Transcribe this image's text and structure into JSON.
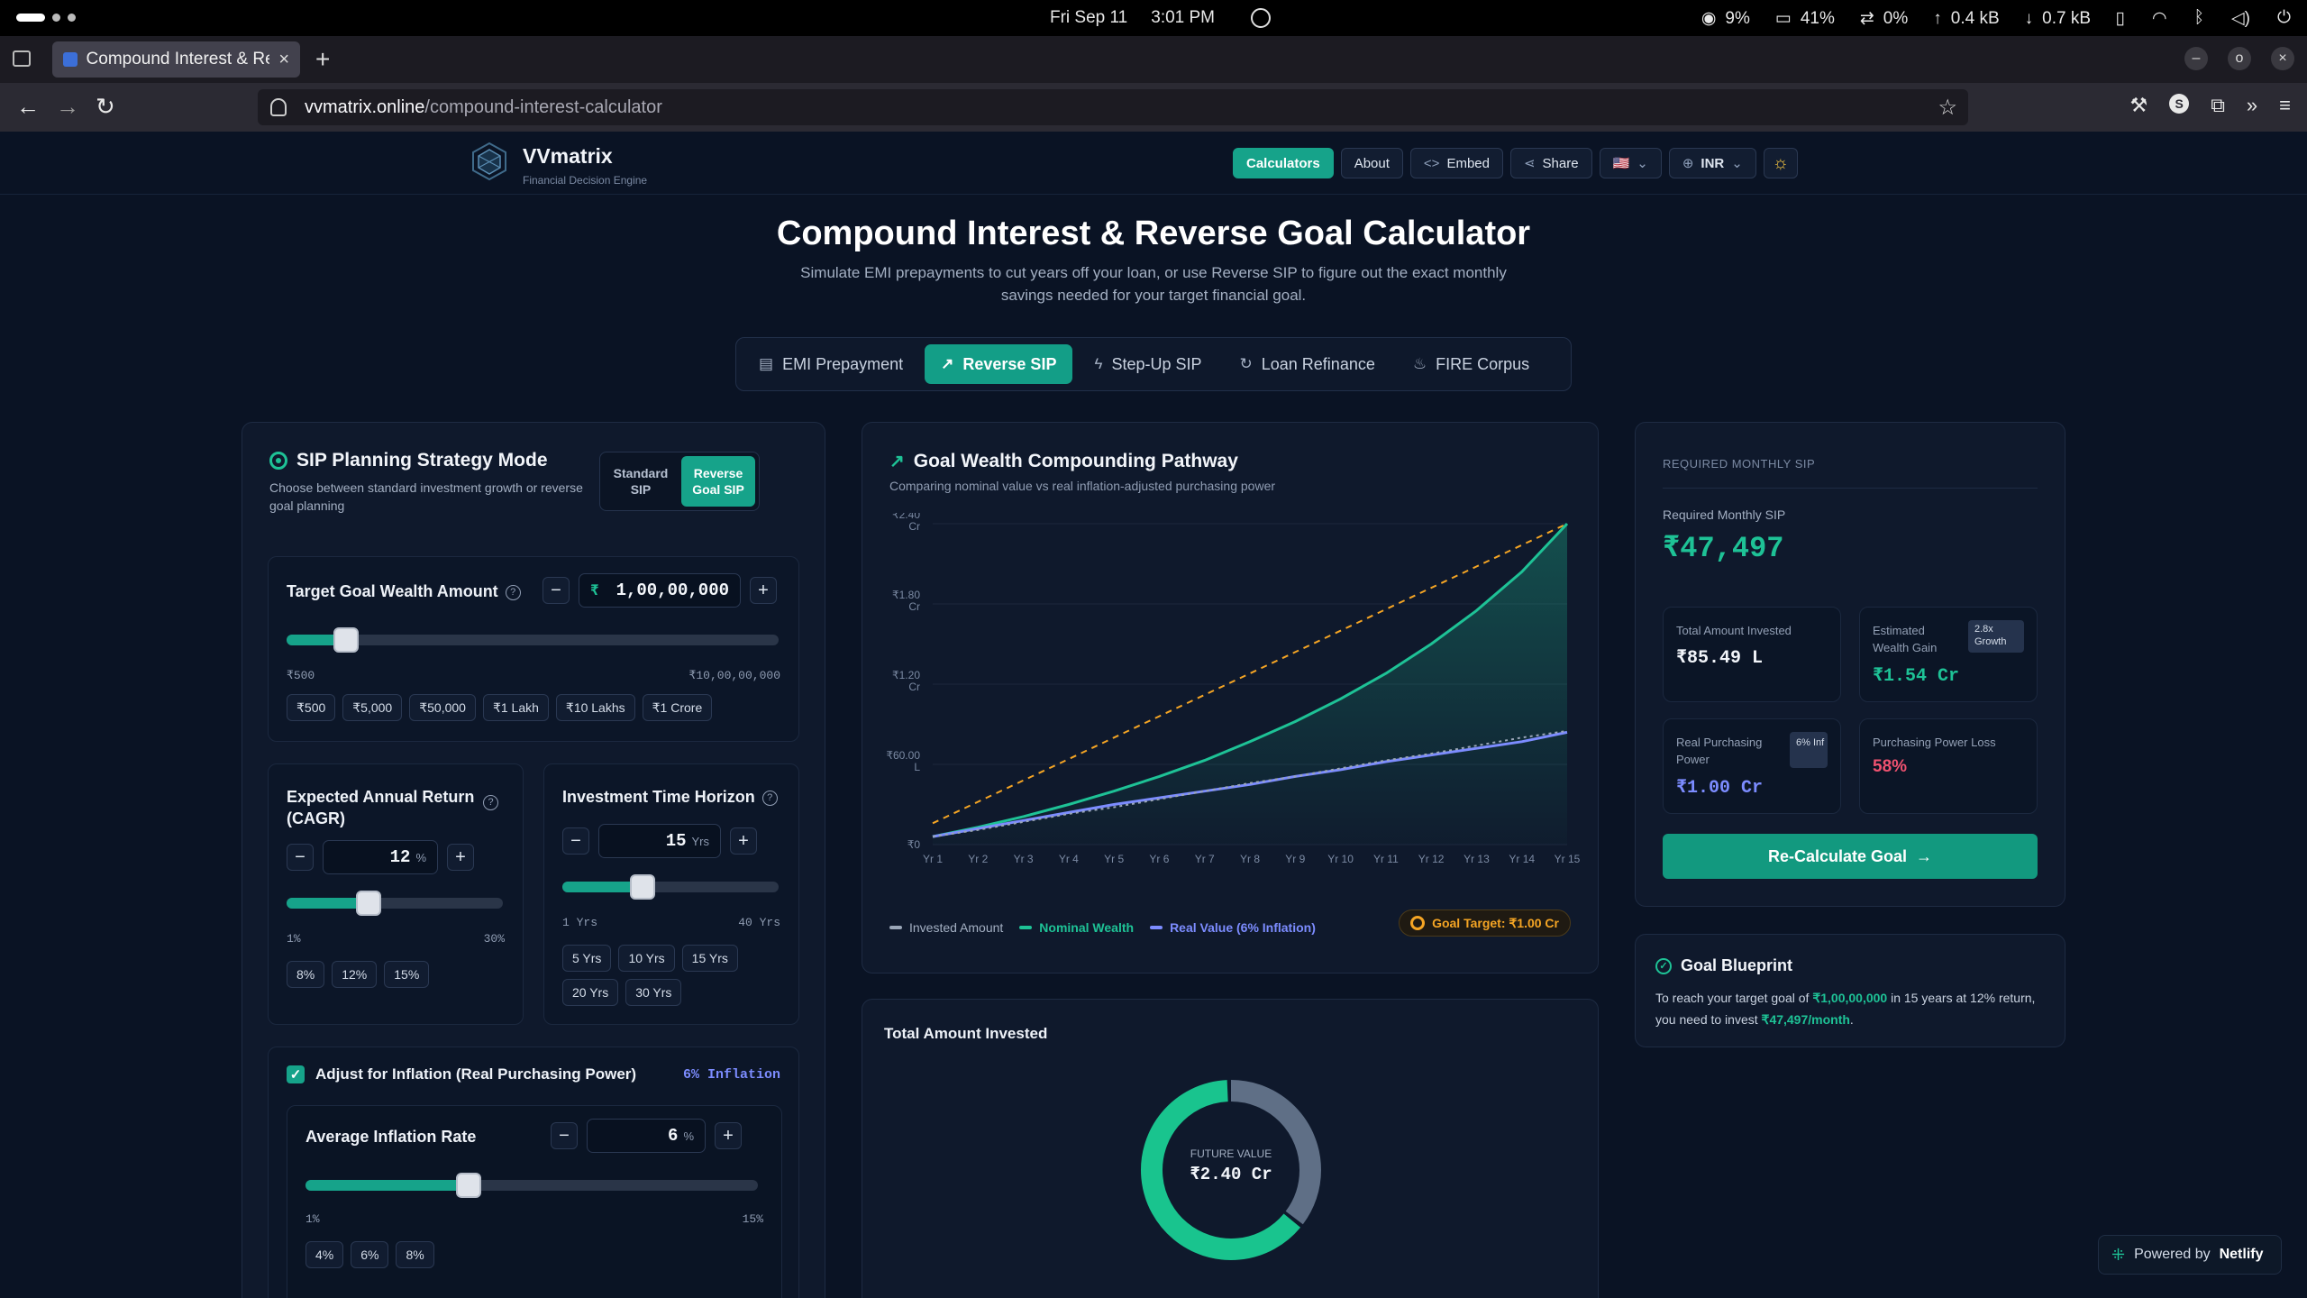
{
  "os": {
    "date": "Fri Sep 11",
    "time": "3:01 PM",
    "stats": [
      {
        "icon": "cpu-icon",
        "value": "9%"
      },
      {
        "icon": "memory-icon",
        "value": "41%"
      },
      {
        "icon": "swap-icon",
        "value": "0%"
      },
      {
        "icon": "upload-icon",
        "value": "0.4 kB"
      },
      {
        "icon": "download-icon",
        "value": "0.7 kB"
      }
    ]
  },
  "browser": {
    "tab_title": "Compound Interest & Reverse Goal Calculator",
    "url_host": "vvmatrix.online",
    "url_path": "/compound-interest-calculator"
  },
  "header": {
    "brand": "VVmatrix",
    "tagline": "Financial Decision Engine",
    "nav": {
      "calculators": "Calculators",
      "about": "About",
      "embed": "Embed",
      "share": "Share",
      "flag": "🇺🇸",
      "currency": "INR"
    }
  },
  "hero": {
    "title": "Compound Interest & Reverse Goal Calculator",
    "subtitle": "Simulate EMI prepayments to cut years off your loan, or use Reverse SIP to figure out the exact monthly savings needed for your target financial goal."
  },
  "modes": [
    "EMI Prepayment",
    "Reverse SIP",
    "Step-Up SIP",
    "Loan Refinance",
    "FIRE Corpus"
  ],
  "strategy": {
    "title": "SIP Planning Strategy Mode",
    "desc": "Choose between standard investment growth or reverse goal planning",
    "opt_standard": "Standard SIP",
    "opt_reverse": "Reverse Goal SIP"
  },
  "goal": {
    "label": "Target Goal Wealth Amount",
    "currency": "₹",
    "value": "1,00,00,000",
    "min": "₹500",
    "max": "₹10,00,00,000",
    "slider_pct": 12,
    "presets": [
      "₹500",
      "₹5,000",
      "₹50,000",
      "₹1 Lakh",
      "₹10 Lakhs",
      "₹1 Crore"
    ]
  },
  "cagr": {
    "label": "Expected Annual Return (CAGR)",
    "value": "12",
    "unit": "%",
    "min": "1%",
    "max": "30%",
    "slider_pct": 38,
    "presets": [
      "8%",
      "12%",
      "15%"
    ]
  },
  "horizon": {
    "label": "Investment Time Horizon",
    "value": "15",
    "unit": "Yrs",
    "min": "1 Yrs",
    "max": "40 Yrs",
    "slider_pct": 37,
    "presets": [
      "5 Yrs",
      "10 Yrs",
      "15 Yrs",
      "20 Yrs",
      "30 Yrs"
    ]
  },
  "inflation": {
    "toggle_label": "Adjust for Inflation (Real Purchasing Power)",
    "badge": "6% Inflation",
    "rate_label": "Average Inflation Rate",
    "value": "6",
    "unit": "%",
    "min": "1%",
    "max": "15%",
    "slider_pct": 36,
    "presets": [
      "4%",
      "6%",
      "8%"
    ]
  },
  "chart_card": {
    "title": "Goal Wealth Compounding Pathway",
    "subtitle": "Comparing nominal value vs real inflation-adjusted purchasing power",
    "legend_invested": "Invested Amount",
    "legend_nominal": "Nominal Wealth",
    "legend_real": "Real Value (6% Inflation)",
    "goal_target": "Goal Target: ₹1.00 Cr"
  },
  "chart_data": {
    "type": "line",
    "x": [
      "Yr 1",
      "Yr 2",
      "Yr 3",
      "Yr 4",
      "Yr 5",
      "Yr 6",
      "Yr 7",
      "Yr 8",
      "Yr 9",
      "Yr 10",
      "Yr 11",
      "Yr 12",
      "Yr 13",
      "Yr 14",
      "Yr 15"
    ],
    "y_ticks": [
      "₹0",
      "₹60.00 L",
      "₹1.20 Cr",
      "₹1.80 Cr",
      "₹2.40 Cr"
    ],
    "ylim": [
      0,
      240
    ],
    "y_unit": "Lakh",
    "series": [
      {
        "name": "Goal Target",
        "style": "dashed",
        "color": "#f5a524",
        "values": [
          16,
          32,
          48,
          64,
          80,
          96,
          112,
          128,
          144,
          160,
          176,
          192,
          208,
          224,
          240
        ]
      },
      {
        "name": "Nominal Wealth",
        "color": "#1ec296",
        "area": true,
        "values": [
          6,
          13,
          21,
          30,
          40,
          51,
          63,
          77,
          92,
          109,
          128,
          150,
          175,
          204,
          240
        ]
      },
      {
        "name": "Real Value (6% Inflation)",
        "color": "#7c8cff",
        "values": [
          6,
          12,
          18,
          24,
          30,
          35,
          40,
          45,
          51,
          56,
          62,
          67,
          72,
          77,
          84
        ]
      },
      {
        "name": "Invested Amount",
        "style": "dotted",
        "color": "#9aa6b8",
        "values": [
          6,
          11,
          17,
          23,
          28,
          34,
          40,
          46,
          51,
          57,
          63,
          68,
          74,
          80,
          85
        ]
      }
    ],
    "grid": true
  },
  "donut": {
    "title": "Total Amount Invested",
    "center_label": "FUTURE VALUE",
    "center_value": "₹2.40 Cr",
    "invested_fraction": 0.36,
    "colors": {
      "invested": "#5f6f86",
      "gain": "#19c48e"
    }
  },
  "results": {
    "section_label": "Required Monthly SIP",
    "sip_label": "Required Monthly SIP",
    "sip_value": "₹47,497",
    "total_invested_label": "Total Amount Invested",
    "total_invested_value": "₹85.49 L",
    "wealth_gain_label": "Estimated Wealth Gain",
    "wealth_gain_badge": "2.8x Growth",
    "wealth_gain_value": "₹1.54 Cr",
    "real_power_label": "Real Purchasing Power",
    "real_power_badge": "6% Inf",
    "real_power_value": "₹1.00 Cr",
    "power_loss_label": "Purchasing Power Loss",
    "power_loss_value": "58%",
    "cta": "Re-Calculate Goal"
  },
  "blueprint": {
    "title": "Goal Blueprint",
    "t1": "To reach your target goal of ",
    "goal": "₹1,00,00,000",
    "t2": " in 15 years at 12% return, you need to invest ",
    "monthly": "₹47,497/month",
    "t3": "."
  },
  "footer": {
    "powered": "Powered by",
    "provider": "Netlify"
  },
  "colors": {
    "accent": "#16a38a",
    "nominal": "#1ec296",
    "real": "#7c8cff",
    "goal": "#f5a524",
    "loss": "#f05270"
  }
}
